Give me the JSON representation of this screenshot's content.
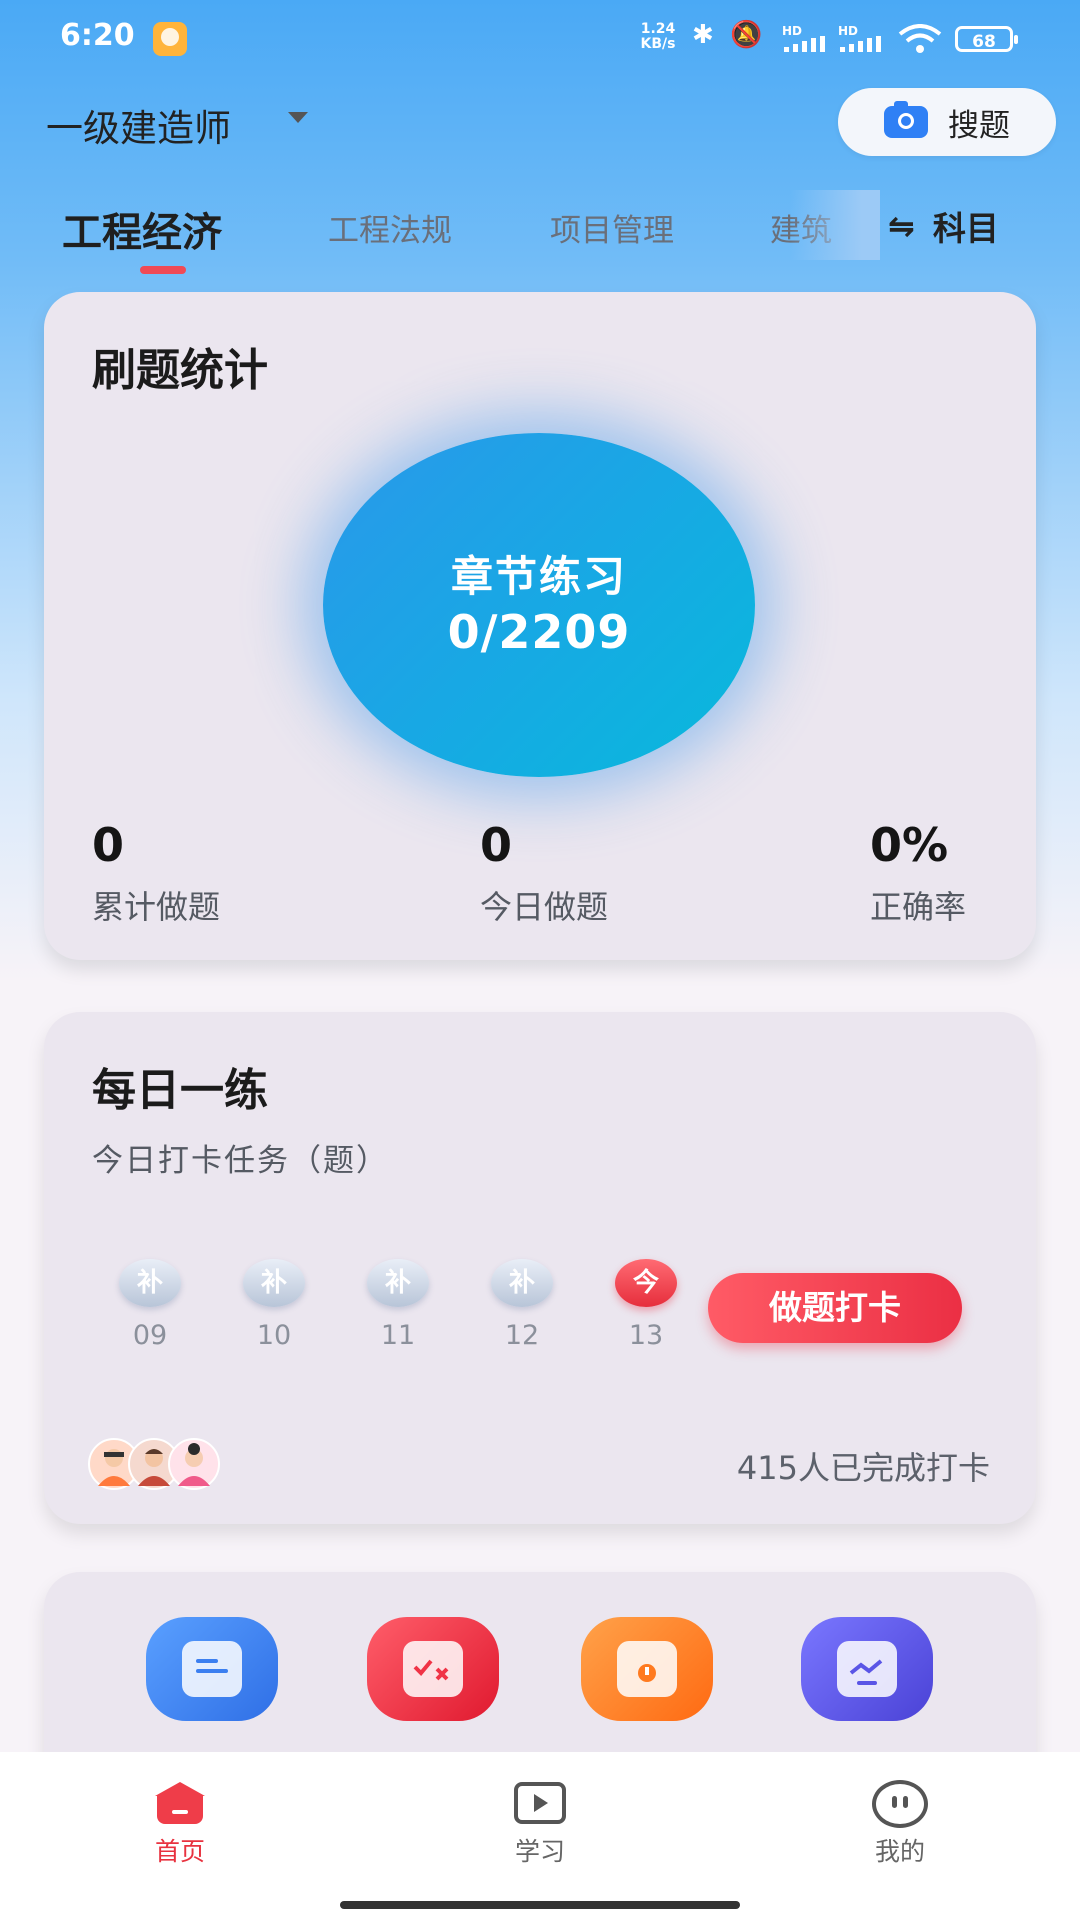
{
  "status_bar": {
    "time": "6:20",
    "net_speed_value": "1.24",
    "net_speed_unit": "KB/s",
    "bluetooth_icon": "bluetooth-icon",
    "mute_icon": "mute-icon",
    "hd1": "HD",
    "hd2": "HD",
    "signal_icon": "signal-icon",
    "wifi_icon": "wifi-icon",
    "battery": "68"
  },
  "header": {
    "exam_name": "一级建造师",
    "search_label": "搜题"
  },
  "tabs": [
    {
      "label": "工程经济",
      "active": true
    },
    {
      "label": "工程法规",
      "active": false
    },
    {
      "label": "项目管理",
      "active": false
    },
    {
      "label": "建筑",
      "active": false
    }
  ],
  "subject_switch": {
    "icon": "⇋",
    "label": "科目"
  },
  "stats_card": {
    "title": "刷题统计",
    "circle_label": "章节练习",
    "circle_value": "0/2209",
    "stats": [
      {
        "value": "0",
        "label": "累计做题"
      },
      {
        "value": "0",
        "label": "今日做题"
      },
      {
        "value": "0%",
        "label": "正确率"
      }
    ]
  },
  "daily_card": {
    "title": "每日一练",
    "subtitle": "今日打卡任务（题）",
    "days": [
      {
        "badge": "补",
        "day": "09"
      },
      {
        "badge": "补",
        "day": "10"
      },
      {
        "badge": "补",
        "day": "11"
      },
      {
        "badge": "补",
        "day": "12"
      },
      {
        "badge": "今",
        "day": "13",
        "today": true
      }
    ],
    "checkin_button": "做题打卡",
    "completed_text": "415人已完成打卡"
  },
  "tools": [
    {
      "icon": "notes-icon",
      "color": "#3b7ff0"
    },
    {
      "icon": "wrong-questions-icon",
      "color": "#f03346"
    },
    {
      "icon": "favorites-folder-icon",
      "color": "#ff7a1f"
    },
    {
      "icon": "report-chart-icon",
      "color": "#5a55e6"
    }
  ],
  "bottom_nav": [
    {
      "label": "首页",
      "icon": "home-icon",
      "active": true
    },
    {
      "label": "学习",
      "icon": "study-icon",
      "active": false
    },
    {
      "label": "我的",
      "icon": "profile-icon",
      "active": false
    }
  ],
  "colors": {
    "accent_red": "#e8323f",
    "circle_blue": "#1ea6e6"
  }
}
